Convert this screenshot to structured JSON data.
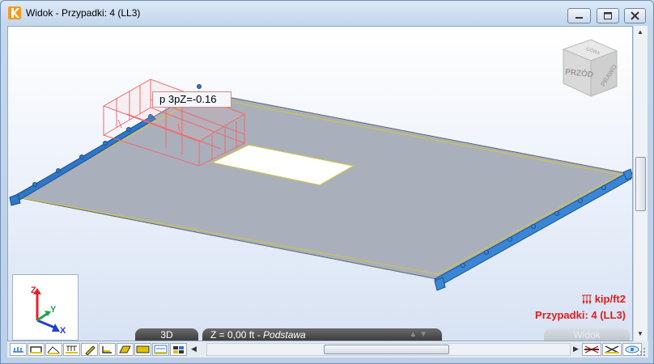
{
  "window": {
    "title": "Widok - Przypadki: 4 (LL3)",
    "controls": {
      "minimize": "—",
      "maximize": "▭",
      "close": "✕"
    }
  },
  "viewcube": {
    "face_front": "PRZÓD",
    "face_right": "PRAWO",
    "face_top": "GÓRA"
  },
  "probe": {
    "label": "p 3pZ=-0.16"
  },
  "axes": {
    "z": "Z",
    "y": "Y",
    "x": "X"
  },
  "legend": {
    "unit": "kip/ft2",
    "case": "Przypadki: 4 (LL3)"
  },
  "statusbar": {
    "view_mode": "3D",
    "level_prefix": "Z = 0,00 ft - ",
    "level_name": "Podstawa",
    "level_arrows": "▲ ▼",
    "view_button": "Widok"
  },
  "colors": {
    "slab": "#a9b0bb",
    "edge": "#c8c25a",
    "support": "#2e77c9",
    "load": "#f06a6a",
    "accent_red": "#e21d1d"
  }
}
